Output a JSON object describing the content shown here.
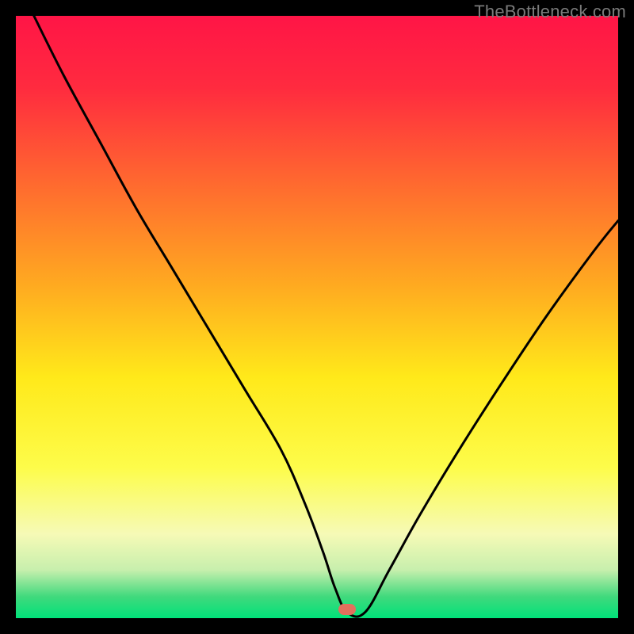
{
  "watermark": {
    "text": "TheBottleneck.com"
  },
  "colors": {
    "background": "#000000",
    "curve": "#000000",
    "marker": "#e2705d",
    "gradient_stops": [
      {
        "offset": 0.0,
        "color": "#ff1546"
      },
      {
        "offset": 0.12,
        "color": "#ff2b3f"
      },
      {
        "offset": 0.28,
        "color": "#ff6a2f"
      },
      {
        "offset": 0.45,
        "color": "#ffab20"
      },
      {
        "offset": 0.6,
        "color": "#ffe91a"
      },
      {
        "offset": 0.75,
        "color": "#fdfc4a"
      },
      {
        "offset": 0.86,
        "color": "#f6fab6"
      },
      {
        "offset": 0.92,
        "color": "#c7efad"
      },
      {
        "offset": 0.965,
        "color": "#3fd97c"
      },
      {
        "offset": 1.0,
        "color": "#00e27a"
      }
    ]
  },
  "chart_data": {
    "type": "line",
    "title": "",
    "xlabel": "",
    "ylabel": "",
    "xlim": [
      0,
      100
    ],
    "ylim": [
      0,
      100
    ],
    "marker": {
      "x": 55,
      "y": 1.5
    },
    "series": [
      {
        "name": "bottleneck-curve",
        "x": [
          3,
          8,
          14,
          20,
          26,
          32,
          38,
          44,
          48,
          51,
          53,
          55,
          58,
          62,
          67,
          73,
          80,
          88,
          96,
          100
        ],
        "y": [
          100,
          90,
          79,
          68,
          58,
          48,
          38,
          28,
          19,
          11,
          5,
          1,
          1,
          8,
          17,
          27,
          38,
          50,
          61,
          66
        ]
      }
    ]
  }
}
